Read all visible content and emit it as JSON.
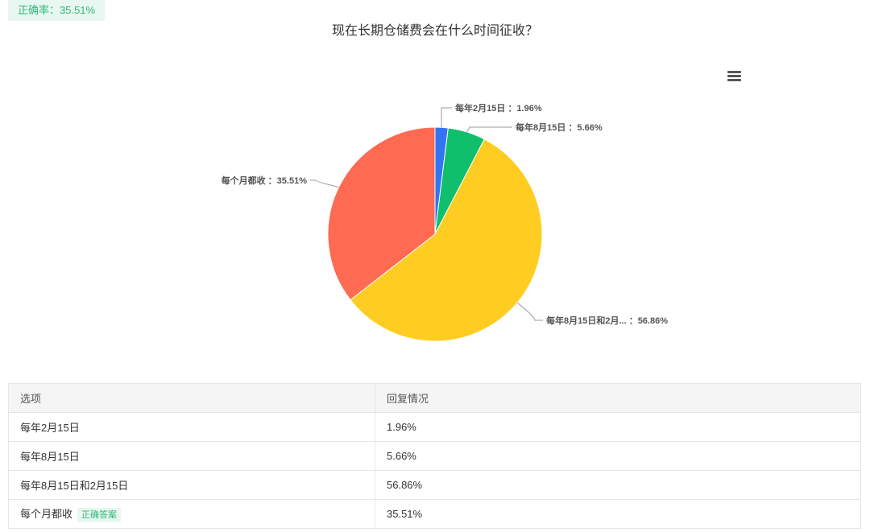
{
  "header": {
    "accuracy": "正确率：35.51%"
  },
  "chart_data": {
    "type": "pie",
    "title": "现在长期仓储费会在什么时间征收？",
    "slices": [
      {
        "label": "每年2月15日",
        "value": 1.96,
        "display": "每年2月15日 ：1.96%",
        "color": "#3374f2"
      },
      {
        "label": "每年8月15日",
        "value": 5.66,
        "display": "每年8月15日 ：5.66%",
        "color": "#0fbf6b"
      },
      {
        "label": "每年8月15日和2月15日",
        "value": 56.86,
        "display": "每年8月15日和2月... ：56.86%",
        "color": "#ffcd22"
      },
      {
        "label": "每个月都收",
        "value": 35.51,
        "display": "每个月都收 ：35.51%",
        "color": "#ff6a53"
      }
    ]
  },
  "table": {
    "headers": [
      "选项",
      "回复情况"
    ],
    "rows": [
      {
        "option": "每年2月15日",
        "value": "1.96%",
        "correct": false
      },
      {
        "option": "每年8月15日",
        "value": "5.66%",
        "correct": false
      },
      {
        "option": "每年8月15日和2月15日",
        "value": "56.86%",
        "correct": false
      },
      {
        "option": "每个月都收",
        "value": "35.51%",
        "correct": true
      }
    ],
    "correct_tag": "正确答案"
  }
}
